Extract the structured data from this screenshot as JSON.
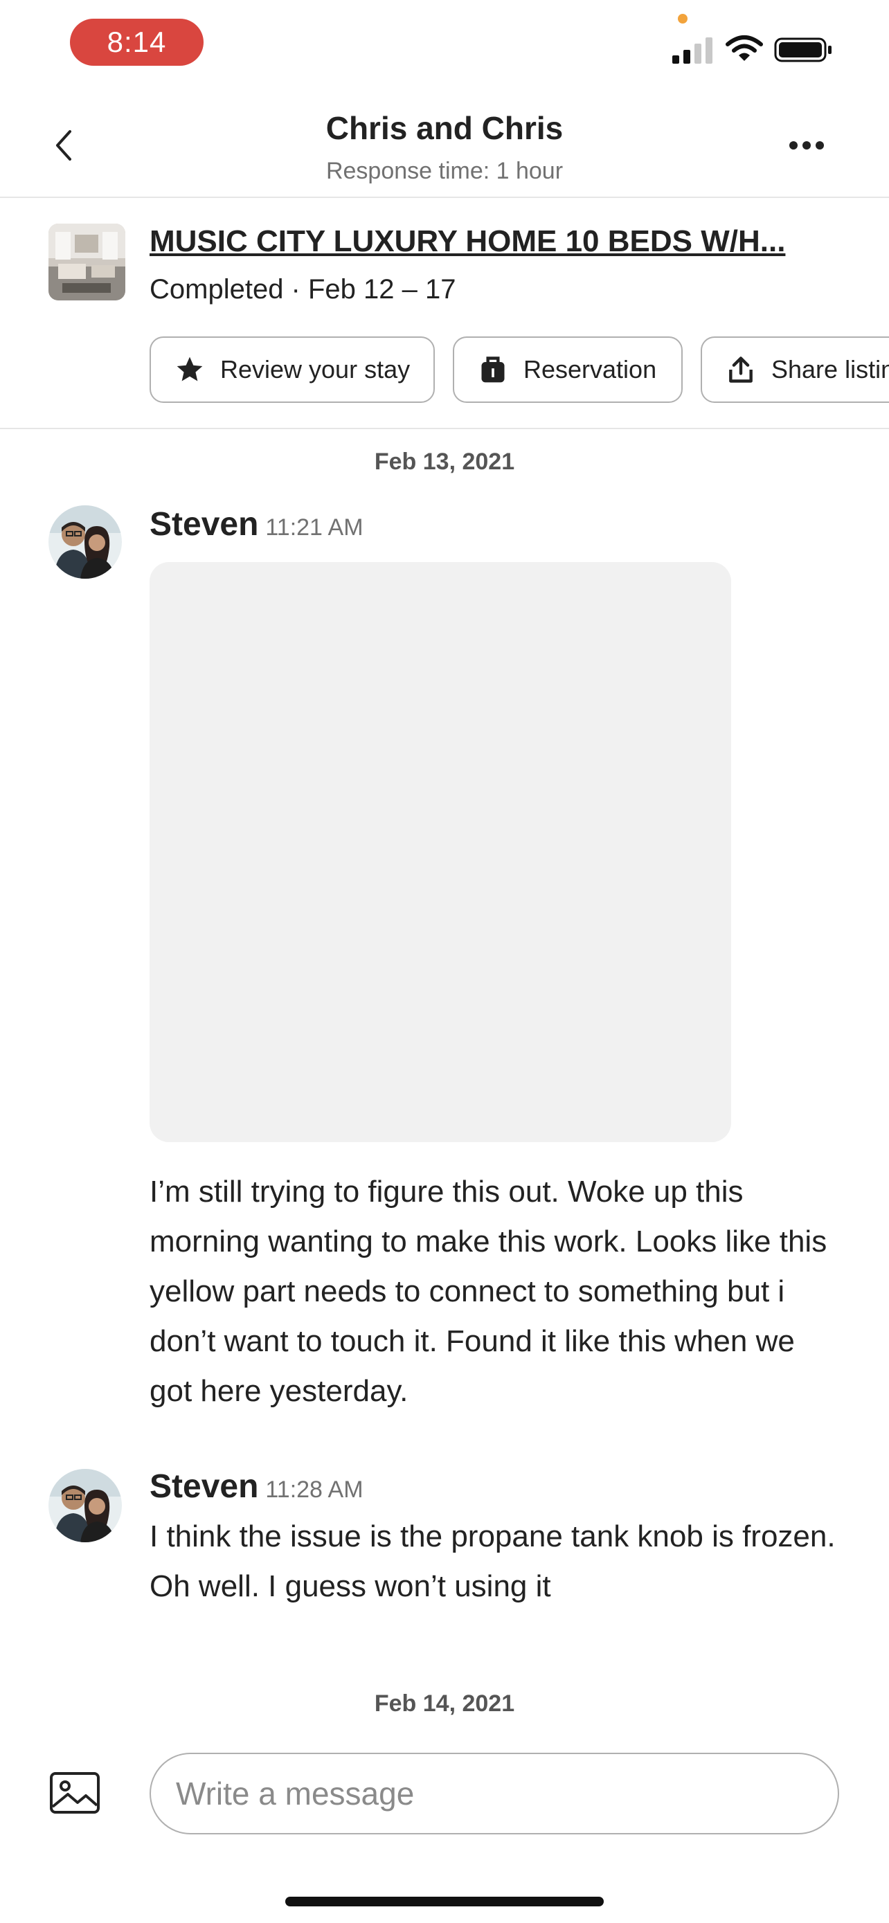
{
  "status_bar": {
    "time": "8:14"
  },
  "header": {
    "title": "Chris and Chris",
    "subtitle": "Response time: 1 hour"
  },
  "listing": {
    "title": "MUSIC CITY LUXURY HOME 10 BEDS W/H...",
    "meta": "Completed · Feb 12 – 17",
    "actions": [
      {
        "label": "Review your stay",
        "icon": "star-icon"
      },
      {
        "label": "Reservation",
        "icon": "luggage-icon"
      },
      {
        "label": "Share listing",
        "icon": "share-icon"
      }
    ]
  },
  "thread": {
    "date_1": "Feb 13, 2021",
    "messages": [
      {
        "sender": "Steven",
        "time": "11:21 AM",
        "text": "I’m still trying to figure this out. Woke up this morning wanting to make this work. Looks like this yellow part needs to connect to something but i don’t want to touch it. Found it like this when we got here yesterday."
      },
      {
        "sender": "Steven",
        "time": "11:28 AM",
        "text": "I think the issue is the propane tank knob is frozen. Oh well. I guess won’t using it"
      }
    ],
    "date_2": "Feb 14, 2021"
  },
  "composer": {
    "placeholder": "Write a message"
  },
  "colors": {
    "accent_time_pill": "#d9463f",
    "text": "#222222",
    "muted": "#717171",
    "border": "#b0b0b0"
  }
}
